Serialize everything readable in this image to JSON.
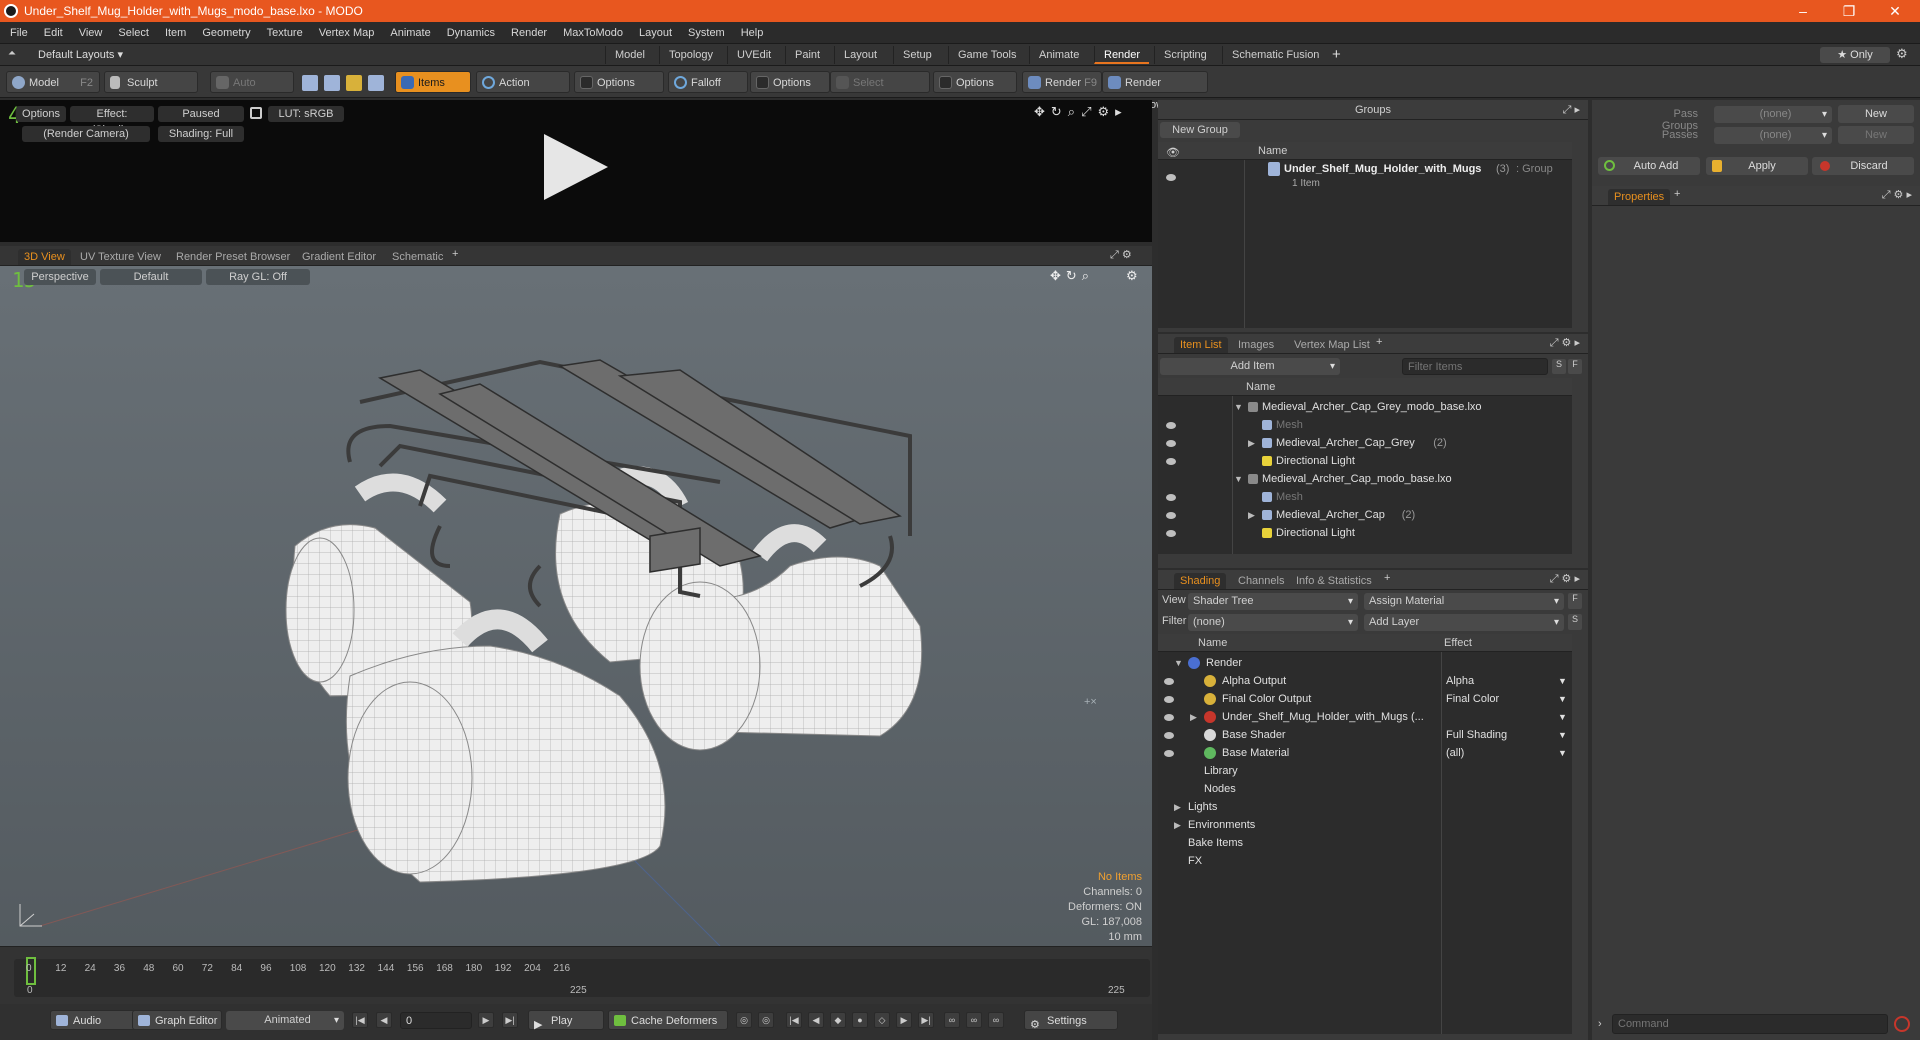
{
  "window": {
    "title": "Under_Shelf_Mug_Holder_with_Mugs_modo_base.lxo - MODO",
    "minimize": "–",
    "restore": "❐",
    "close": "✕"
  },
  "menu": [
    "File",
    "Edit",
    "View",
    "Select",
    "Item",
    "Geometry",
    "Texture",
    "Vertex Map",
    "Animate",
    "Dynamics",
    "Render",
    "MaxToModo",
    "Layout",
    "System",
    "Help"
  ],
  "layout": {
    "preset": "Default Layouts ▾",
    "tabs": [
      "Model",
      "Topology",
      "UVEdit",
      "Paint",
      "Layout",
      "Setup",
      "Game Tools",
      "Animate",
      "Render",
      "Scripting",
      "Schematic Fusion"
    ],
    "active_tab": "Render",
    "only": "★  Only"
  },
  "toolbar": {
    "model": "Model",
    "model_key": "F2",
    "sculpt": "Sculpt",
    "auto_select": "Auto Select",
    "items": "Items",
    "action_center": "Action Center",
    "options1": "Options",
    "falloff": "Falloff",
    "options2": "Options",
    "select_through": "Select Through",
    "options3": "Options",
    "render": "Render",
    "render_key": "F9",
    "render_window": "Render Window"
  },
  "render_preview": {
    "options": "Options",
    "effect": "Effect: (Shadi...",
    "paused": "Paused",
    "lut": "LUT: sRGB",
    "camera": "(Render Camera)",
    "shading": "Shading: Full",
    "badge": "4"
  },
  "viewport": {
    "tabs": [
      "3D View",
      "UV Texture View",
      "Render Preset Browser",
      "Gradient Editor",
      "Schematic"
    ],
    "active_tab": "3D View",
    "perspective": "Perspective",
    "default": "Default",
    "raygl": "Ray GL: Off",
    "badge": "15",
    "stats": {
      "no_items": "No Items",
      "channels": "Channels: 0",
      "deformers": "Deformers: ON",
      "gl": "GL: 187,008",
      "scale": "10 mm"
    }
  },
  "timeline": {
    "ticks": [
      "0",
      "12",
      "24",
      "36",
      "48",
      "60",
      "72",
      "84",
      "96",
      "108",
      "120",
      "132",
      "144",
      "156",
      "168",
      "180",
      "192",
      "204",
      "216"
    ],
    "start": "0",
    "mid": "225",
    "end": "225",
    "current": "0"
  },
  "bottombar": {
    "audio": "Audio",
    "graph_editor": "Graph Editor",
    "animated": "Animated",
    "frame": "0",
    "play": "Play",
    "cache_deformers": "Cache Deformers",
    "settings": "Settings"
  },
  "groups": {
    "title": "Groups",
    "new_group": "New Group",
    "name_col": "Name",
    "item": {
      "name": "Under_Shelf_Mug_Holder_with_Mugs",
      "count": "(3)",
      "type": ": Group",
      "sub": "1 Item"
    }
  },
  "pass_panel": {
    "pass_groups_label": "Pass Groups",
    "pass_groups_value": "(none)",
    "passes_label": "Passes",
    "passes_value": "(none)",
    "new1": "New",
    "new2": "New",
    "auto_add": "Auto Add",
    "apply": "Apply",
    "discard": "Discard",
    "properties_tab": "Properties",
    "command_placeholder": "Command"
  },
  "item_list": {
    "tabs": [
      "Item List",
      "Images",
      "Vertex Map List"
    ],
    "active_tab": "Item List",
    "add_item": "Add Item",
    "filter_placeholder": "Filter Items",
    "name_col": "Name",
    "rows": [
      {
        "label": "Medieval_Archer_Cap_Grey_modo_base.lxo",
        "indent": 0,
        "expander": "▼",
        "dim": false,
        "count": ""
      },
      {
        "label": "Mesh",
        "indent": 1,
        "expander": "",
        "dim": true,
        "count": ""
      },
      {
        "label": "Medieval_Archer_Cap_Grey",
        "indent": 1,
        "expander": "▶",
        "dim": false,
        "count": "(2)"
      },
      {
        "label": "Directional Light",
        "indent": 1,
        "expander": "",
        "dim": false,
        "count": ""
      },
      {
        "label": "Medieval_Archer_Cap_modo_base.lxo",
        "indent": 0,
        "expander": "▼",
        "dim": false,
        "count": ""
      },
      {
        "label": "Mesh",
        "indent": 1,
        "expander": "",
        "dim": true,
        "count": ""
      },
      {
        "label": "Medieval_Archer_Cap",
        "indent": 1,
        "expander": "▶",
        "dim": false,
        "count": "(2)"
      },
      {
        "label": "Directional Light",
        "indent": 1,
        "expander": "",
        "dim": false,
        "count": ""
      }
    ]
  },
  "shading": {
    "tabs": [
      "Shading",
      "Channels",
      "Info & Statistics"
    ],
    "active_tab": "Shading",
    "view_label": "View",
    "view_value": "Shader Tree",
    "assign_material": "Assign Material",
    "filter_label": "Filter",
    "filter_value": "(none)",
    "add_layer": "Add Layer",
    "name_col": "Name",
    "effect_col": "Effect",
    "rows": [
      {
        "label": "Render",
        "effect": "",
        "indent": 0,
        "expander": "▼",
        "eye": false,
        "color": "#4a6fd1"
      },
      {
        "label": "Alpha Output",
        "effect": "Alpha",
        "indent": 1,
        "expander": "",
        "eye": true,
        "color": "#d8b13a"
      },
      {
        "label": "Final Color Output",
        "effect": "Final Color",
        "indent": 1,
        "expander": "",
        "eye": true,
        "color": "#d8b13a"
      },
      {
        "label": "Under_Shelf_Mug_Holder_with_Mugs (...",
        "effect": "",
        "indent": 1,
        "expander": "▶",
        "eye": true,
        "color": "#c7362b"
      },
      {
        "label": "Base Shader",
        "effect": "Full Shading",
        "indent": 1,
        "expander": "",
        "eye": true,
        "color": "#d8d8d8"
      },
      {
        "label": "Base Material",
        "effect": "(all)",
        "indent": 1,
        "expander": "",
        "eye": true,
        "color": "#5fb85f"
      },
      {
        "label": "Library",
        "effect": "",
        "indent": 1,
        "expander": "",
        "eye": false,
        "color": ""
      },
      {
        "label": "Nodes",
        "effect": "",
        "indent": 1,
        "expander": "",
        "eye": false,
        "color": ""
      },
      {
        "label": "Lights",
        "effect": "",
        "indent": 0,
        "expander": "▶",
        "eye": false,
        "color": ""
      },
      {
        "label": "Environments",
        "effect": "",
        "indent": 0,
        "expander": "▶",
        "eye": false,
        "color": ""
      },
      {
        "label": "Bake Items",
        "effect": "",
        "indent": 0,
        "expander": "",
        "eye": false,
        "color": ""
      },
      {
        "label": "FX",
        "effect": "",
        "indent": 0,
        "expander": "",
        "eye": false,
        "color": ""
      }
    ]
  },
  "colors": {
    "accent": "#e8901f",
    "titlebar": "#e8571f",
    "viewport_bg": "#5d656a"
  }
}
